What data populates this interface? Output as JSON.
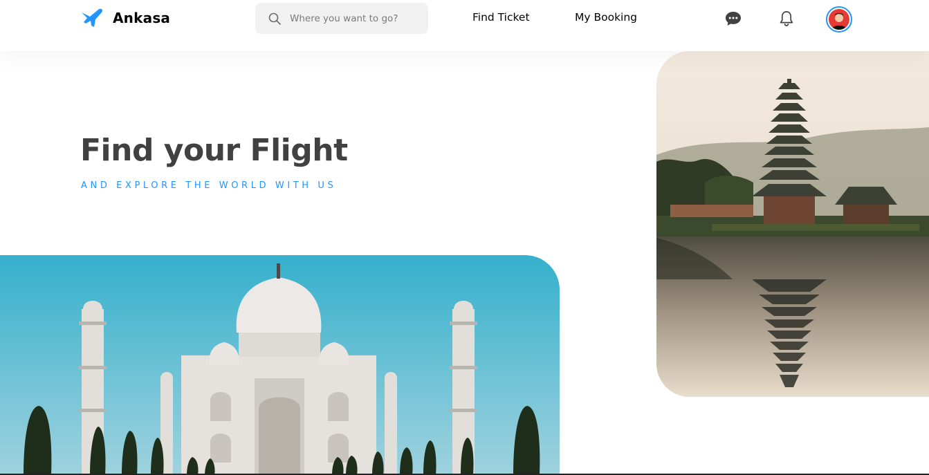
{
  "brand": {
    "name": "Ankasa",
    "icon": "plane-logo-icon",
    "color": "#2395ff"
  },
  "search": {
    "placeholder": "Where you want to go?",
    "value": "",
    "icon": "search-icon"
  },
  "nav": {
    "find_ticket": "Find Ticket",
    "my_booking": "My Booking"
  },
  "header_icons": {
    "chat": "chat-bubble-icon",
    "notifications": "bell-icon",
    "avatar": "user-avatar"
  },
  "hero": {
    "title": "Find your Flight",
    "subtitle": "AND EXPLORE THE WORLD WITH US"
  },
  "images": {
    "left": "Taj Mahal photo",
    "right": "Bali lake temple photo"
  },
  "colors": {
    "accent": "#2395ff",
    "title": "#414141",
    "search_bg": "#f1f1f1"
  }
}
